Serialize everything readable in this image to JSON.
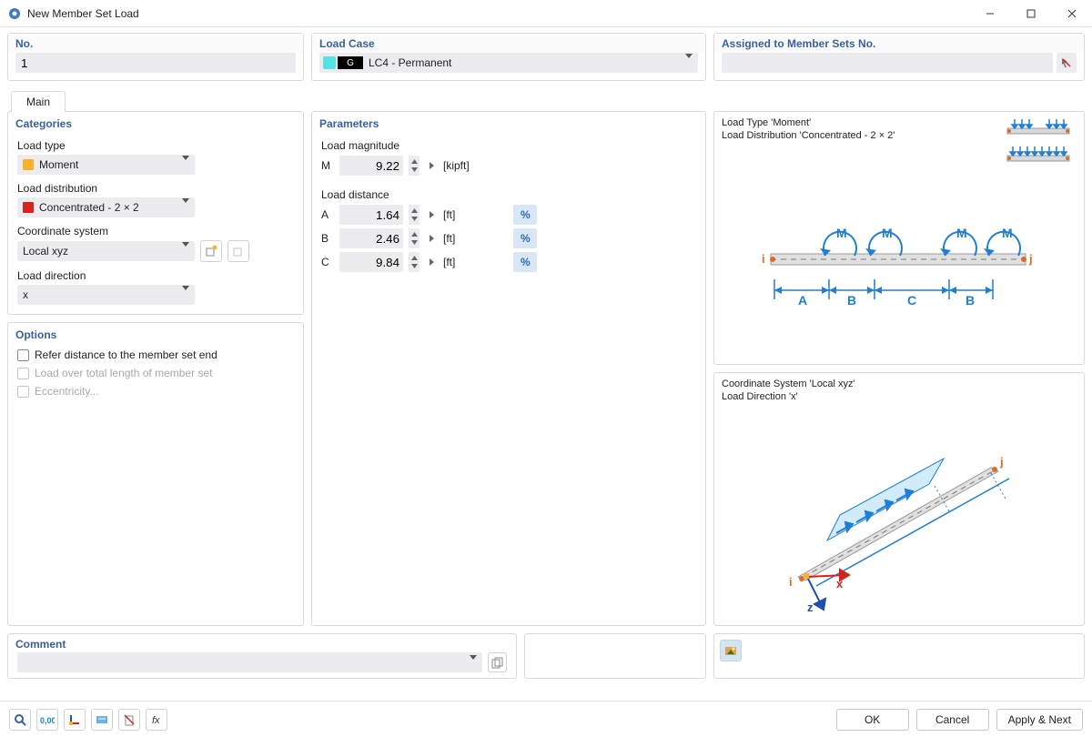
{
  "window": {
    "title": "New Member Set Load"
  },
  "top": {
    "no_label": "No.",
    "no_value": "1",
    "loadcase_label": "Load Case",
    "loadcase_tag": "G",
    "loadcase_value": "LC4 - Permanent",
    "assigned_label": "Assigned to Member Sets No.",
    "assigned_value": ""
  },
  "tabs": {
    "main": "Main"
  },
  "categories": {
    "title": "Categories",
    "load_type_label": "Load type",
    "load_type_value": "Moment",
    "load_dist_label": "Load distribution",
    "load_dist_value": "Concentrated - 2 × 2",
    "coord_label": "Coordinate system",
    "coord_value": "Local xyz",
    "direction_label": "Load direction",
    "direction_value": "x"
  },
  "options": {
    "title": "Options",
    "refer_end": "Refer distance to the member set end",
    "total_length": "Load over total length of member set",
    "eccentricity": "Eccentricity..."
  },
  "parameters": {
    "title": "Parameters",
    "magnitude_label": "Load magnitude",
    "magnitude_sym": "M",
    "magnitude_value": "9.22",
    "magnitude_unit": "[kipft]",
    "distance_label": "Load distance",
    "A_sym": "A",
    "A_value": "1.64",
    "A_unit": "[ft]",
    "B_sym": "B",
    "B_value": "2.46",
    "B_unit": "[ft]",
    "C_sym": "C",
    "C_value": "9.84",
    "C_unit": "[ft]",
    "pct": "%"
  },
  "diagram1": {
    "line1": "Load Type 'Moment'",
    "line2": "Load Distribution 'Concentrated - 2 × 2'",
    "m": "M",
    "i": "i",
    "j": "j",
    "A": "A",
    "B": "B",
    "C": "C"
  },
  "diagram2": {
    "line1": "Coordinate System 'Local xyz'",
    "line2": "Load Direction 'x'",
    "i": "i",
    "j": "j",
    "x": "x",
    "z": "z"
  },
  "comment": {
    "title": "Comment",
    "value": ""
  },
  "footer": {
    "ok": "OK",
    "cancel": "Cancel",
    "apply_next": "Apply & Next"
  }
}
